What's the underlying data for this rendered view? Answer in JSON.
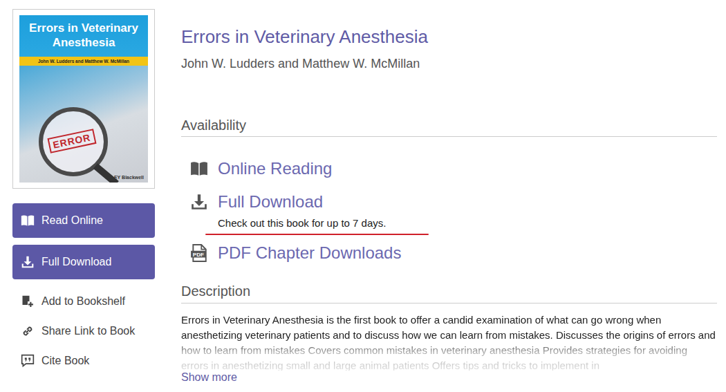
{
  "book": {
    "title": "Errors in Veterinary Anesthesia",
    "authors": "John W. Ludders and Matthew W. McMillan"
  },
  "cover": {
    "title": "Errors in Veterinary Anesthesia",
    "authors": "John W. Ludders and Matthew W. McMillan",
    "stamp": "ERROR",
    "publisher": "WILEY Blackwell"
  },
  "actions": [
    {
      "label": "Read Online",
      "kind": "button"
    },
    {
      "label": "Full Download",
      "kind": "button"
    },
    {
      "label": "Add to Bookshelf",
      "kind": "link"
    },
    {
      "label": "Share Link to Book",
      "kind": "link"
    },
    {
      "label": "Cite Book",
      "kind": "link"
    }
  ],
  "availability": {
    "heading": "Availability",
    "options": [
      {
        "label": "Online Reading"
      },
      {
        "label": "Full Download",
        "note": {
          "text": "Check out this book for up to 7 days.",
          "underlined": true
        }
      },
      {
        "label": "PDF Chapter Downloads",
        "icon_text": "PDF"
      }
    ]
  },
  "description": {
    "heading": "Description",
    "text": "Errors in Veterinary Anesthesia is the first book to offer a candid examination of what can go wrong when anesthetizing veterinary patients and to discuss how we can learn from mistakes.   Discusses the origins of errors and how to learn from mistakes Covers common mistakes in veterinary anesthesia Provides strategies for avoiding errors in anesthetizing small and large animal patients Offers tips and tricks to implement in",
    "more": "Show more"
  }
}
